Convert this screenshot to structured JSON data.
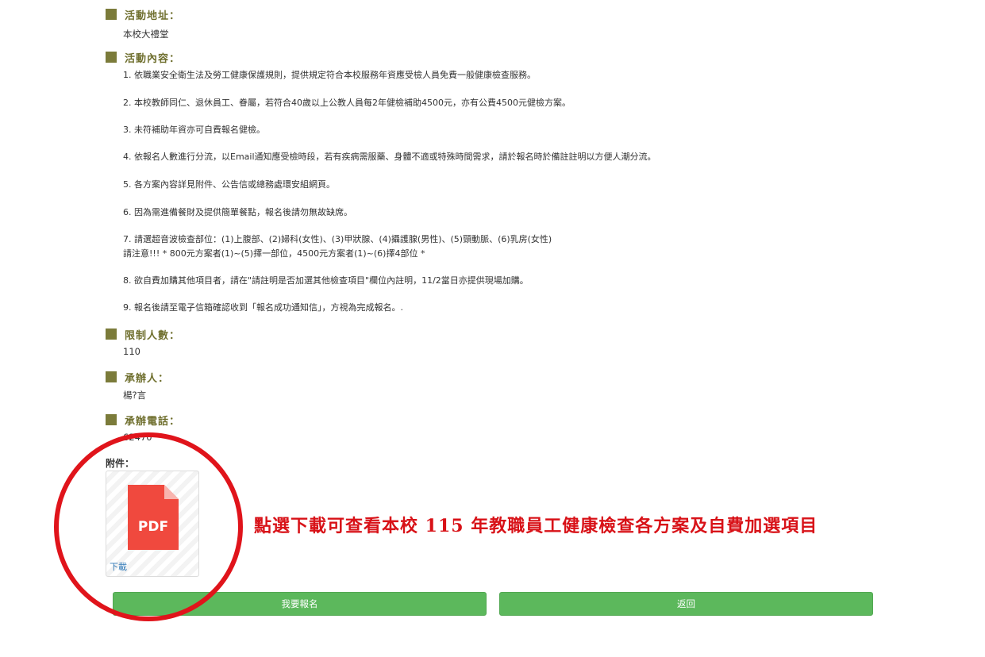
{
  "fields": {
    "venue": {
      "label": "活動地址：",
      "value": "本校大禮堂"
    },
    "content": {
      "label": "活動內容：",
      "items": [
        "1. 依職業安全衛生法及勞工健康保護規則，提供規定符合本校服務年資應受檢人員免費一般健康檢查服務。",
        "2. 本校教師同仁、退休員工、眷屬，若符合40歲以上公教人員每2年健檢補助4500元，亦有公費4500元健檢方案。",
        "3. 未符補助年資亦可自費報名健檢。",
        "4. 依報名人數進行分流，以Email通知應受檢時段，若有疾病需服藥、身體不適或特殊時間需求，請於報名時於備註註明以方便人潮分流。",
        "5. 各方案內容詳見附件、公告信或總務處環安組網頁。",
        "6. 因為需進備餐財及提供簡單餐點，報名後請勿無故缺席。",
        "7. 請選超音波檢查部位：(1)上腹部、(2)婦科(女性)、(3)甲狀腺、(4)攝護腺(男性)、(5)頸動脈、(6)乳房(女性)",
        "請注意!!! * 800元方案者(1)~(5)擇一部位，4500元方案者(1)~(6)擇4部位 *",
        "8. 欲自費加購其他項目者，請在\"請註明是否加選其他檢查項目\"欄位內註明，11/2當日亦提供現場加購。",
        "9. 報名後請至電子信箱確認收到「報名成功通知信」，方視為完成報名。."
      ]
    },
    "capacity": {
      "label": "限制人數：",
      "value": "110"
    },
    "organizer": {
      "label": "承辦人：",
      "value": "楊?言"
    },
    "phone": {
      "label": "承辦電話：",
      "value": "62470"
    }
  },
  "attachment": {
    "label": "附件：",
    "icon_text": "PDF",
    "icon": "pdf-file-icon",
    "download_label": "下載"
  },
  "buttons": {
    "register": "我要報名",
    "back": "返回"
  },
  "annotation": {
    "text": "點選下載可查看本校 115 年教職員工健康檢查各方案及自費加選項目",
    "color": "#d81218"
  },
  "colors": {
    "section_marker": "#7b7b3a",
    "button": "#5cb85c",
    "pdf": "#f0493e"
  }
}
